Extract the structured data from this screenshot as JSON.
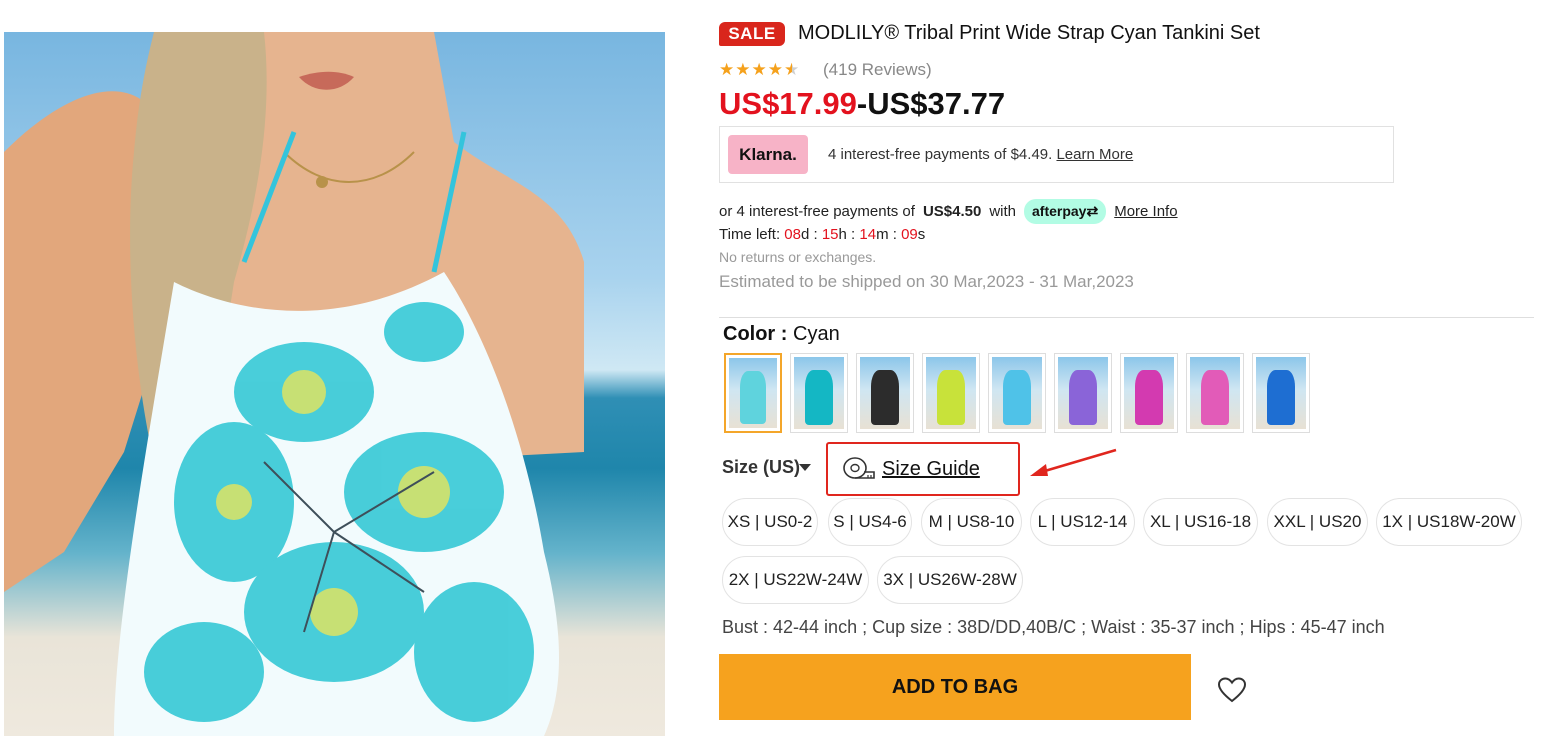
{
  "product": {
    "badge": "SALE",
    "title": "MODLILY® Tribal Print Wide Strap Cyan Tankini Set",
    "rating": 4.5,
    "reviews": "(419 Reviews)",
    "price_low": "US$17.99",
    "price_sep": "-",
    "price_high": "US$37.77"
  },
  "klarna": {
    "logo": "Klarna.",
    "text": "4 interest-free payments of $4.49.",
    "link": "Learn More"
  },
  "afterpay": {
    "prefix": "or 4 interest-free payments of",
    "amount": "US$4.50",
    "with": "with",
    "logo": "afterpay",
    "link": "More Info"
  },
  "timer": {
    "label": "Time left:",
    "days": "08",
    "d": "d :",
    "hours": "15",
    "h": "h :",
    "minutes": "14",
    "m": "m :",
    "seconds": "09",
    "s": "s"
  },
  "notice": "No returns or exchanges.",
  "shipping": "Estimated to be shipped on 30 Mar,2023 - 31 Mar,2023",
  "color": {
    "label": "Color :",
    "value": "Cyan",
    "swatches": [
      {
        "color": "#5fd3dd",
        "selected": true
      },
      {
        "color": "#14b7c4",
        "selected": false
      },
      {
        "color": "#2c2c2c",
        "selected": false
      },
      {
        "color": "#c8e23a",
        "selected": false
      },
      {
        "color": "#4fc2e8",
        "selected": false
      },
      {
        "color": "#8a64d8",
        "selected": false
      },
      {
        "color": "#d33ab0",
        "selected": false
      },
      {
        "color": "#e25bb8",
        "selected": false
      },
      {
        "color": "#1e6ed2",
        "selected": false
      }
    ]
  },
  "size": {
    "label": "Size (US)",
    "guide": "Size Guide",
    "options": [
      "XS | US0-2",
      "S | US4-6",
      "M | US8-10",
      "L | US12-14",
      "XL | US16-18",
      "XXL | US20",
      "1X | US18W-20W",
      "2X | US22W-24W",
      "3X | US26W-28W"
    ]
  },
  "measurements": "Bust : 42-44 inch ; Cup size : 38D/DD,40B/C ; Waist : 35-37 inch ; Hips : 45-47 inch",
  "cta": {
    "add_to_bag": "ADD TO BAG"
  },
  "colors": {
    "sale": "#d9261c",
    "price": "#e3121e",
    "star": "#f5a11c",
    "cta": "#f6a21e",
    "highlight": "#e0261e"
  }
}
